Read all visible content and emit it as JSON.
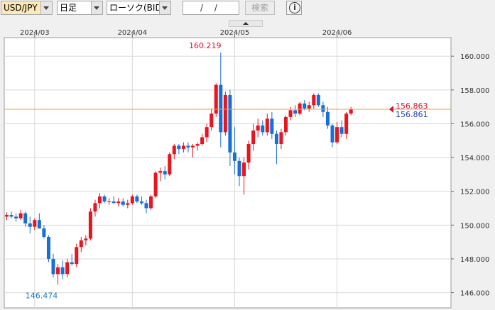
{
  "toolbar": {
    "symbol": "USD/JPY",
    "timeframe": "日足",
    "chart_type": "ローソク(BID)",
    "date_value": "/ /",
    "search_label": "検索",
    "info_icon": "i"
  },
  "colors": {
    "up": "#e8141e",
    "down": "#1a6ed8",
    "line": "#f0a040",
    "grid": "#d8d8d8",
    "high_label": "#d0143c",
    "low_label": "#1a78c2",
    "bid_label": "#d0143c",
    "ask_label": "#2040b0"
  },
  "chart_data": {
    "type": "candlestick",
    "title": "",
    "ylim": [
      145.1,
      161.1
    ],
    "y_ticks": [
      "146.000",
      "148.000",
      "150.000",
      "152.000",
      "154.000",
      "156.000",
      "158.000",
      "160.000"
    ],
    "x_tick_labels": [
      "2024/03",
      "2024/04",
      "2024/05",
      "2024/06"
    ],
    "x_tick_index": [
      6,
      27,
      49,
      71
    ],
    "grid": true,
    "current_bid": "156.863",
    "current_ask": "156.861",
    "current_price": 156.86,
    "high_label": "160.219",
    "high_index": 46,
    "high_value": 160.219,
    "low_label": "146.474",
    "low_index": 11,
    "low_value": 146.474,
    "candles": [
      [
        150.5,
        150.75,
        150.3,
        150.6
      ],
      [
        150.6,
        150.8,
        150.4,
        150.5
      ],
      [
        150.5,
        150.7,
        150.2,
        150.4
      ],
      [
        150.4,
        150.9,
        150.3,
        150.7
      ],
      [
        150.7,
        150.8,
        149.9,
        150.1
      ],
      [
        150.1,
        150.5,
        149.5,
        149.9
      ],
      [
        149.9,
        150.4,
        149.7,
        150.3
      ],
      [
        150.3,
        150.7,
        149.8,
        149.8
      ],
      [
        149.8,
        150.0,
        149.2,
        149.3
      ],
      [
        149.3,
        149.4,
        147.8,
        148.0
      ],
      [
        148.0,
        148.3,
        146.9,
        147.1
      ],
      [
        147.1,
        147.7,
        146.47,
        147.5
      ],
      [
        147.5,
        147.9,
        146.8,
        147.1
      ],
      [
        147.1,
        148.0,
        146.9,
        147.8
      ],
      [
        147.8,
        148.3,
        147.6,
        147.7
      ],
      [
        147.7,
        148.9,
        147.5,
        148.7
      ],
      [
        148.7,
        149.3,
        148.4,
        149.1
      ],
      [
        149.1,
        149.4,
        148.8,
        149.2
      ],
      [
        149.2,
        151.0,
        149.1,
        150.8
      ],
      [
        150.8,
        151.5,
        150.5,
        151.3
      ],
      [
        151.3,
        151.9,
        151.0,
        151.7
      ],
      [
        151.7,
        151.8,
        151.3,
        151.4
      ],
      [
        151.4,
        151.6,
        151.2,
        151.4
      ],
      [
        151.4,
        151.7,
        151.3,
        151.3
      ],
      [
        151.3,
        151.6,
        151.1,
        151.4
      ],
      [
        151.4,
        151.6,
        151.1,
        151.2
      ],
      [
        151.2,
        151.5,
        151.0,
        151.3
      ],
      [
        151.3,
        151.8,
        151.2,
        151.7
      ],
      [
        151.7,
        151.8,
        151.3,
        151.4
      ],
      [
        151.4,
        151.7,
        151.2,
        151.3
      ],
      [
        151.3,
        151.5,
        150.7,
        151.0
      ],
      [
        151.0,
        151.8,
        150.9,
        151.7
      ],
      [
        151.7,
        153.2,
        151.6,
        153.1
      ],
      [
        153.1,
        153.4,
        152.6,
        153.2
      ],
      [
        153.2,
        153.5,
        152.7,
        153.0
      ],
      [
        153.0,
        154.3,
        152.9,
        154.2
      ],
      [
        154.2,
        154.8,
        153.9,
        154.7
      ],
      [
        154.7,
        154.8,
        154.2,
        154.5
      ],
      [
        154.5,
        154.9,
        154.3,
        154.7
      ],
      [
        154.7,
        154.9,
        154.3,
        154.6
      ],
      [
        154.6,
        154.8,
        154.0,
        154.7
      ],
      [
        154.7,
        154.9,
        154.4,
        154.8
      ],
      [
        154.8,
        155.4,
        154.7,
        155.2
      ],
      [
        155.2,
        156.0,
        154.9,
        155.8
      ],
      [
        155.8,
        156.9,
        155.6,
        156.6
      ],
      [
        156.6,
        158.4,
        156.4,
        158.3
      ],
      [
        158.3,
        160.219,
        154.6,
        155.5
      ],
      [
        155.5,
        157.9,
        155.3,
        157.7
      ],
      [
        157.7,
        158.0,
        153.5,
        154.3
      ],
      [
        154.3,
        155.8,
        153.0,
        153.8
      ],
      [
        153.8,
        154.0,
        152.3,
        152.9
      ],
      [
        152.9,
        154.0,
        151.8,
        153.7
      ],
      [
        153.7,
        155.0,
        153.3,
        154.8
      ],
      [
        154.8,
        156.0,
        154.4,
        155.6
      ],
      [
        155.6,
        156.3,
        155.2,
        155.9
      ],
      [
        155.9,
        156.2,
        155.3,
        155.5
      ],
      [
        155.5,
        156.6,
        155.3,
        156.3
      ],
      [
        156.3,
        156.7,
        155.1,
        155.4
      ],
      [
        155.4,
        155.6,
        153.6,
        154.8
      ],
      [
        154.8,
        155.7,
        154.5,
        155.5
      ],
      [
        155.5,
        156.5,
        155.3,
        156.4
      ],
      [
        156.4,
        157.0,
        156.2,
        156.8
      ],
      [
        156.8,
        157.1,
        156.4,
        156.6
      ],
      [
        156.6,
        157.3,
        156.5,
        157.2
      ],
      [
        157.2,
        157.4,
        156.8,
        156.9
      ],
      [
        156.9,
        157.3,
        156.7,
        157.1
      ],
      [
        157.1,
        157.8,
        156.9,
        157.7
      ],
      [
        157.7,
        157.8,
        157.0,
        157.1
      ],
      [
        157.1,
        157.3,
        156.4,
        156.7
      ],
      [
        156.7,
        157.0,
        155.7,
        155.9
      ],
      [
        155.9,
        156.0,
        154.6,
        154.9
      ],
      [
        154.9,
        156.1,
        154.8,
        155.8
      ],
      [
        155.8,
        156.2,
        155.2,
        155.4
      ],
      [
        155.4,
        156.7,
        155.1,
        156.6
      ],
      [
        156.6,
        157.0,
        156.5,
        156.86
      ]
    ]
  }
}
